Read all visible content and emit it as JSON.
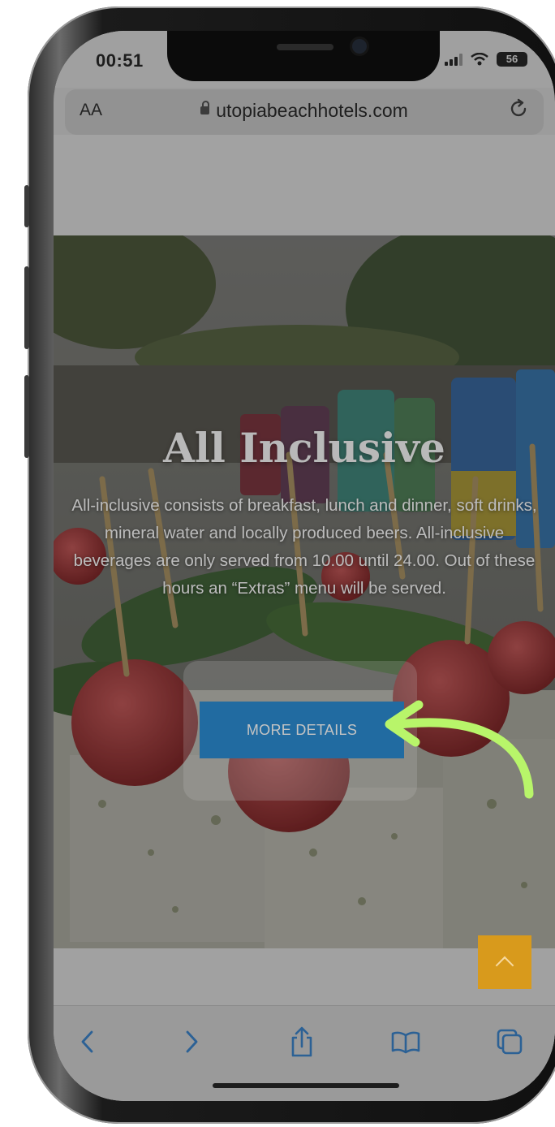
{
  "status_bar": {
    "time": "00:51",
    "battery": "56"
  },
  "browser": {
    "aa_label": "AA",
    "url": "utopiabeachhotels.com"
  },
  "hero": {
    "title": "All Inclusive",
    "description": "All-inclusive consists of breakfast, lunch and dinner, soft drinks, mineral water and locally produced beers. All-inclusive beverages are only served from 10.00 until 24.00. Out of these hours an “Extras” menu will be served.",
    "button_label": "MORE DETAILS"
  },
  "colors": {
    "button": "#1f86d0",
    "scroll_top": "#d89a1c",
    "annotation_arrow": "#b8f56a"
  },
  "icons": {
    "toolbar": [
      "back-icon",
      "forward-icon",
      "share-icon",
      "bookmarks-icon",
      "tabs-icon"
    ],
    "annotation": "arrow-icon"
  }
}
